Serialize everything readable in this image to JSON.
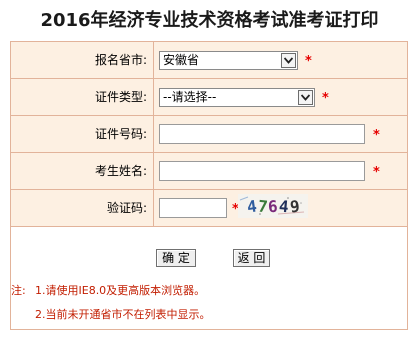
{
  "page_title": "2016年经济专业技术资格考试准考证打印",
  "form": {
    "province": {
      "label": "报名省市:",
      "selected": "安徽省"
    },
    "id_type": {
      "label": "证件类型:",
      "selected": "--请选择--"
    },
    "id_number": {
      "label": "证件号码:",
      "value": ""
    },
    "name": {
      "label": "考生姓名:",
      "value": ""
    },
    "captcha": {
      "label": "验证码:",
      "value": "",
      "code": "47649",
      "digits": [
        "4",
        "7",
        "6",
        "4",
        "9"
      ]
    },
    "required_mark": "*"
  },
  "buttons": {
    "confirm": "确 定",
    "back": "返 回"
  },
  "notes": {
    "prefix": "注:",
    "line1": "1.请使用IE8.0及更高版本浏览器。",
    "line2": "2.当前未开通省市不在列表中显示。"
  },
  "colors": {
    "row_bg": "#fdf0e2",
    "border": "#e2b39a",
    "required": "#e60000",
    "note_text": "#c21d00"
  }
}
